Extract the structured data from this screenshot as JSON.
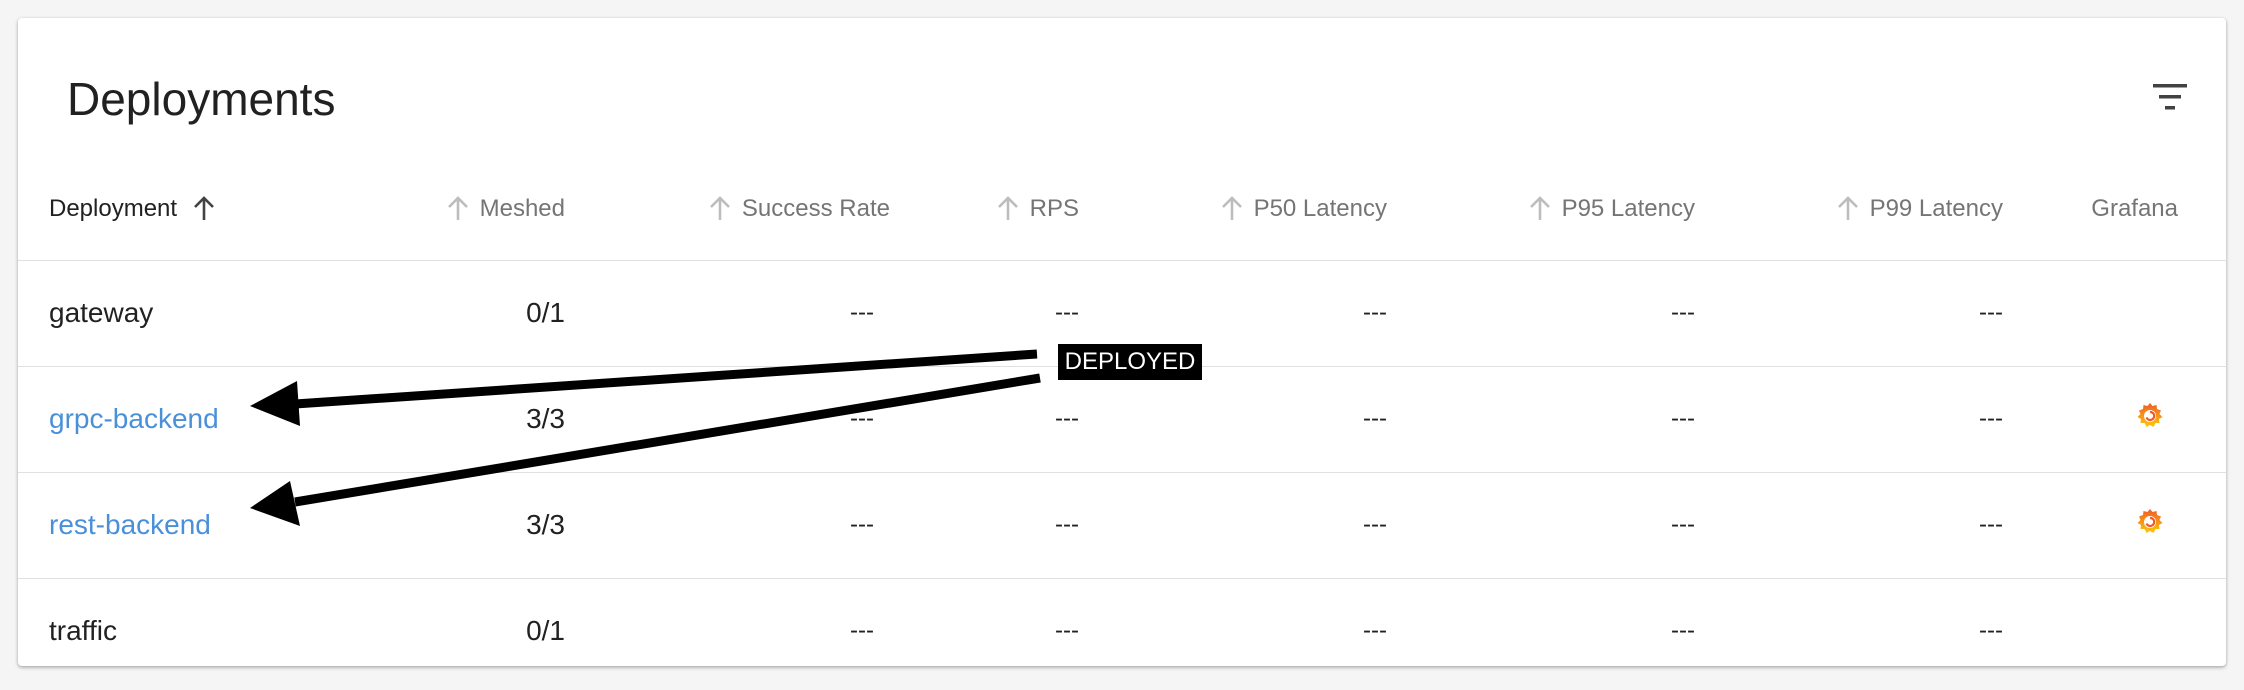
{
  "card": {
    "title": "Deployments",
    "filter_icon": "filter-list-icon"
  },
  "table": {
    "columns": [
      {
        "label": "Deployment",
        "sorted": true,
        "sort_icon": "arrow-upward-icon"
      },
      {
        "label": "Meshed",
        "sort_icon": "arrow-upward-icon"
      },
      {
        "label": "Success Rate",
        "sort_icon": "arrow-upward-icon"
      },
      {
        "label": "RPS",
        "sort_icon": "arrow-upward-icon"
      },
      {
        "label": "P50 Latency",
        "sort_icon": "arrow-upward-icon"
      },
      {
        "label": "P95 Latency",
        "sort_icon": "arrow-upward-icon"
      },
      {
        "label": "P99 Latency",
        "sort_icon": "arrow-upward-icon"
      },
      {
        "label": "Grafana"
      }
    ],
    "rows": [
      {
        "name": "gateway",
        "meshed": "0/1",
        "success_rate": "---",
        "rps": "---",
        "p50": "---",
        "p95": "---",
        "p99": "---",
        "grafana": false
      },
      {
        "name": "grpc-backend",
        "meshed": "3/3",
        "success_rate": "---",
        "rps": "---",
        "p50": "---",
        "p95": "---",
        "p99": "---",
        "grafana": true
      },
      {
        "name": "rest-backend",
        "meshed": "3/3",
        "success_rate": "---",
        "rps": "---",
        "p50": "---",
        "p95": "---",
        "p99": "---",
        "grafana": true
      },
      {
        "name": "traffic",
        "meshed": "0/1",
        "success_rate": "---",
        "rps": "---",
        "p50": "---",
        "p95": "---",
        "p99": "---",
        "grafana": false
      }
    ]
  },
  "annotation": {
    "label": "DEPLOYED"
  },
  "colors": {
    "link": "#4a90d9",
    "header_text": "#757575",
    "grafana_orange": "#f05a28",
    "grafana_yellow": "#fbca0a"
  }
}
